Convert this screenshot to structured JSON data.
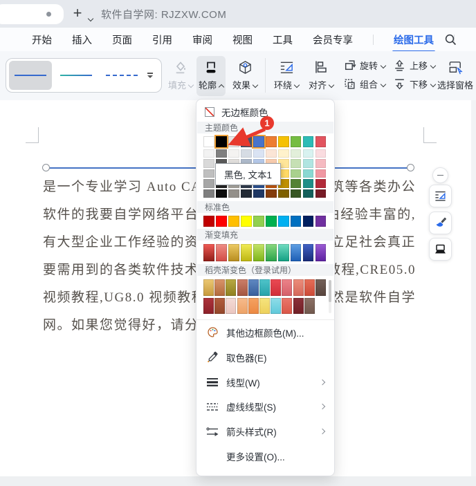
{
  "titlebar": {
    "title": "软件自学网: RJZXW.COM"
  },
  "menubar": {
    "items": [
      "开始",
      "插入",
      "页面",
      "引用",
      "审阅",
      "视图",
      "工具",
      "会员专享",
      "绘图工具"
    ],
    "active_index": 8
  },
  "ribbon": {
    "fill_label": "填充",
    "outline_label": "轮廓",
    "effect_label": "效果",
    "wrap_label": "环绕",
    "align_label": "对齐",
    "rotate_label": "旋转",
    "group_label": "组合",
    "bring_forward_label": "上移",
    "send_backward_label": "下移",
    "selection_pane_label": "选择窗格"
  },
  "dropdown": {
    "no_border_label": "无边框颜色",
    "sections": {
      "theme": "主题颜色",
      "standard": "标准色",
      "gradient": "渐变填充",
      "docer": "稻壳渐变色（登录试用）"
    },
    "tooltip": "黑色, 文本1",
    "badge": "1",
    "accent_selection_color": "#f0a33c",
    "badge_color": "#e8392d",
    "theme_colors": [
      {
        "color": "#ffffff"
      },
      {
        "color": "#000000",
        "selected": true
      },
      {
        "color": "#e7e6e6"
      },
      {
        "color": "#44546a"
      },
      {
        "color": "#4874cb",
        "selected": true
      },
      {
        "color": "#ed7d31"
      },
      {
        "color": "#f5c102"
      },
      {
        "color": "#75bd42"
      },
      {
        "color": "#2dbcb6"
      },
      {
        "color": "#e2545f"
      }
    ],
    "tint_rows": [
      [
        "#f2f2f2",
        "#7f7f7f",
        "#f4f3f1",
        "#d6dce4",
        "#dae3f3",
        "#fbe5d6",
        "#fff2cc",
        "#e2efda",
        "#d8f2f0",
        "#fadce0"
      ],
      [
        "#d9d9d9",
        "#595959",
        "#e0dedb",
        "#adb9ca",
        "#b4c7e7",
        "#f8cbad",
        "#ffe599",
        "#c6e0b4",
        "#b0e5e1",
        "#f5bac1"
      ],
      [
        "#bfbfbf",
        "#404040",
        "#c8c6c1",
        "#8497b0",
        "#8eaadb",
        "#f4b183",
        "#ffd966",
        "#a9d18e",
        "#89d8d2",
        "#f097a2"
      ],
      [
        "#a6a6a6",
        "#262626",
        "#aeaba4",
        "#333f50",
        "#2f5597",
        "#c55a11",
        "#bf9000",
        "#548235",
        "#1f8e87",
        "#b22a3a"
      ],
      [
        "#7f7f7f",
        "#0d0d0d",
        "#94908a",
        "#222a35",
        "#203864",
        "#843c0c",
        "#7f6000",
        "#375623",
        "#14605b",
        "#771c27"
      ]
    ],
    "standard_colors": [
      "#c00000",
      "#fe0000",
      "#ffbf00",
      "#ffff00",
      "#92d050",
      "#00b050",
      "#00b0f0",
      "#0070c0",
      "#002060",
      "#7030a0"
    ],
    "gradients": [
      {
        "from": "#f15b56",
        "to": "#8e1c16"
      },
      {
        "from": "#ef8e86",
        "to": "#d14a44"
      },
      {
        "from": "#edcb64",
        "to": "#b78c1e"
      },
      {
        "from": "#f1ec55",
        "to": "#bdb511"
      },
      {
        "from": "#c4e468",
        "to": "#7cb318"
      },
      {
        "from": "#8ad97e",
        "to": "#27a24b"
      },
      {
        "from": "#72ddc1",
        "to": "#129f82"
      },
      {
        "from": "#60a0e4",
        "to": "#1c5db4"
      },
      {
        "from": "#4263c6",
        "to": "#172a77"
      },
      {
        "from": "#9c5cd4",
        "to": "#5c21a0"
      }
    ],
    "docer_rows": [
      [
        {
          "from": "#ecc873",
          "to": "#c79a3d"
        },
        {
          "from": "#d9946a",
          "to": "#b26a3c"
        },
        {
          "from": "#b8a943",
          "to": "#8f8020"
        },
        {
          "from": "#cc7f69",
          "to": "#a35540"
        },
        {
          "from": "#6089c2",
          "to": "#375e9b"
        },
        {
          "from": "#4fc4ca",
          "to": "#27a2aa"
        },
        {
          "from": "#ea4a54",
          "to": "#d02e39"
        },
        {
          "from": "#ec838a",
          "to": "#d55f69"
        },
        {
          "from": "#ec8d7b",
          "to": "#d5685a"
        },
        {
          "from": "#e66e58",
          "to": "#cc4a37"
        },
        {
          "from": "#746159",
          "to": "#57443d"
        }
      ],
      [
        {
          "from": "#ad333b",
          "to": "#8c2029"
        },
        {
          "from": "#b25e3d",
          "to": "#93462a"
        },
        {
          "from": "#f4dbd7",
          "to": "#eac6c0"
        },
        {
          "from": "#f6bb8d",
          "to": "#eda266"
        },
        {
          "from": "#f5a261",
          "to": "#ec8842"
        },
        {
          "from": "#f6e47e",
          "to": "#edd05b"
        },
        {
          "from": "#8fdde9",
          "to": "#5fc9da"
        },
        {
          "from": "#ea766b",
          "to": "#d95647"
        },
        {
          "from": "#8c3139",
          "to": "#702026"
        },
        {
          "from": "#8d7166",
          "to": "#70584d"
        }
      ]
    ],
    "menu_items": [
      {
        "label": "其他边框颜色(M)...",
        "icon": "palette-icon",
        "submenu": false
      },
      {
        "label": "取色器(E)",
        "icon": "eyedropper-icon",
        "submenu": false
      },
      {
        "label": "线型(W)",
        "icon": "line-style-icon",
        "submenu": true
      },
      {
        "label": "虚线线型(S)",
        "icon": "dash-style-icon",
        "submenu": true
      },
      {
        "label": "箭头样式(R)",
        "icon": "arrow-style-icon",
        "submenu": true
      },
      {
        "label": "更多设置(O)...",
        "icon": null,
        "submenu": false
      }
    ]
  },
  "document": {
    "lines": [
      "是一个专业学习 Auto CAD",
      "软件的我要自学网络平台，",
      "有大型企业工作经验的资",
      "要需用到的各类软件技术",
      "视频教程,UG8.0 视频教程",
      "网。如果您觉得好，请分享"
    ],
    "right_fragments": [
      "筑等各类办公",
      "由经验丰富的,",
      "立足社会真正",
      "教程,CRE05.0",
      "然是软件自学"
    ]
  }
}
